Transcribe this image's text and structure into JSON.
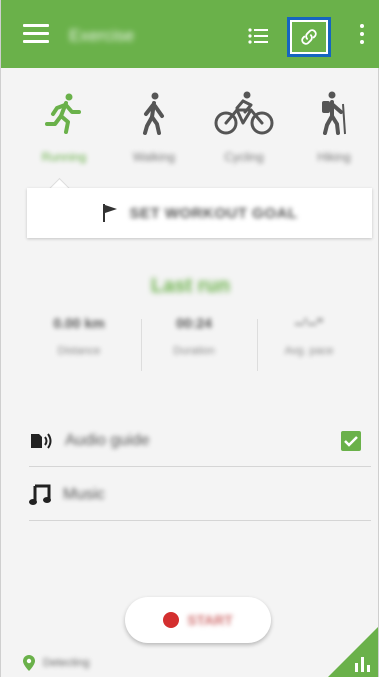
{
  "app_bar": {
    "title": "Exercise",
    "accent_color": "#6ab14a",
    "icons": [
      "menu-icon",
      "list-icon",
      "link-icon",
      "more-vert-icon"
    ]
  },
  "activities": [
    {
      "label": "Running",
      "icon": "running-icon",
      "selected": true
    },
    {
      "label": "Walking",
      "icon": "walking-icon",
      "selected": false
    },
    {
      "label": "Cycling",
      "icon": "cycling-icon",
      "selected": false
    },
    {
      "label": "Hiking",
      "icon": "hiking-icon",
      "selected": false
    }
  ],
  "goal": {
    "label": "SET WORKOUT GOAL",
    "icon": "flag-icon"
  },
  "last_run": {
    "heading": "Last run",
    "stats": [
      {
        "value": "0.00 km",
        "label": "Distance"
      },
      {
        "value": "00:24",
        "label": "Duration"
      },
      {
        "value": "--'--\"",
        "label": "Avg. pace"
      }
    ]
  },
  "settings": {
    "audio_guide": {
      "label": "Audio guide",
      "icon": "audio-guide-icon",
      "checked": true
    },
    "music": {
      "label": "Music",
      "icon": "music-note-icon"
    }
  },
  "start": {
    "label": "START",
    "dot_color": "#d32f2f"
  },
  "footer": {
    "gps_label": "Detecting",
    "gps_icon": "location-pin-icon",
    "chart_icon": "bar-chart-icon"
  }
}
